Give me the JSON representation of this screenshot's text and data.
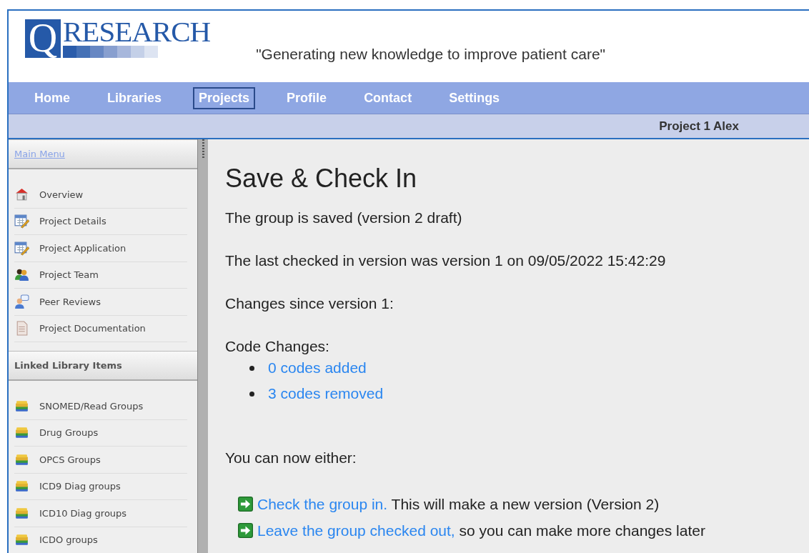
{
  "header": {
    "logo": {
      "letter": "Q",
      "word": "RESEARCH"
    },
    "tagline": "\"Generating new knowledge to improve patient care\""
  },
  "nav": [
    {
      "label": "Home",
      "selected": false
    },
    {
      "label": "Libraries",
      "selected": false
    },
    {
      "label": "Projects",
      "selected": true
    },
    {
      "label": "Profile",
      "selected": false
    },
    {
      "label": "Contact",
      "selected": false
    },
    {
      "label": "Settings",
      "selected": false
    }
  ],
  "subbar": {
    "project": "Project 1 Alex"
  },
  "sidebar": {
    "sections": [
      {
        "title": "Main Menu",
        "kind": "link",
        "items": [
          {
            "label": "Overview",
            "kind": "home"
          },
          {
            "label": "Project Details",
            "kind": "form"
          },
          {
            "label": "Project Application",
            "kind": "form"
          },
          {
            "label": "Project Team",
            "kind": "team"
          },
          {
            "label": "Peer Reviews",
            "kind": "review"
          },
          {
            "label": "Project Documentation",
            "kind": "document"
          }
        ]
      },
      {
        "title": "Linked Library Items",
        "kind": "heading",
        "items": [
          {
            "label": "SNOMED/Read Groups",
            "kind": "library"
          },
          {
            "label": "Drug Groups",
            "kind": "library"
          },
          {
            "label": "OPCS Groups",
            "kind": "library"
          },
          {
            "label": "ICD9 Diag groups",
            "kind": "library"
          },
          {
            "label": "ICD10 Diag groups",
            "kind": "library"
          },
          {
            "label": "ICDO groups",
            "kind": "library"
          }
        ]
      }
    ]
  },
  "content": {
    "title": "Save & Check In",
    "paragraphs": [
      "The group is saved (version 2 draft)",
      "The last checked in version was version 1 on 09/05/2022 15:42:29",
      "Changes since version 1:"
    ],
    "code_changes": {
      "label": "Code Changes:",
      "items": [
        "0 codes added",
        "3 codes removed"
      ]
    },
    "prompt": "You can now either:",
    "actions": [
      {
        "link": "Check the group in.",
        "text": "This will make a new version (Version 2)"
      },
      {
        "link": "Leave the group checked out,",
        "text": "so you can make more changes later"
      }
    ]
  }
}
